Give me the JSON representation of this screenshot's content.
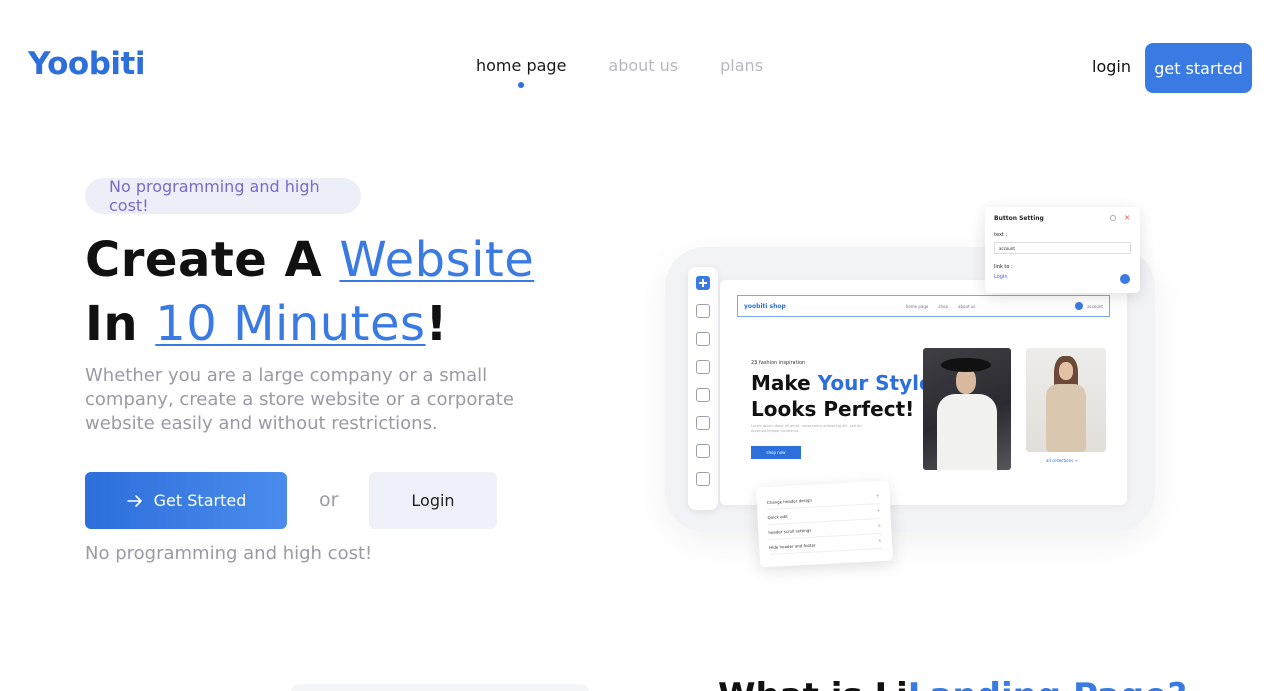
{
  "header": {
    "logo": "Yoobiti",
    "nav": [
      {
        "label": "home page",
        "active": true
      },
      {
        "label": "about us",
        "active": false
      },
      {
        "label": "plans",
        "active": false
      }
    ],
    "login_label": "login",
    "get_started_label": "get started"
  },
  "hero": {
    "pill": "No programming and high cost!",
    "title_line1_prefix": "Create A ",
    "title_line1_accent": "Website",
    "title_line2_prefix": "In ",
    "title_line2_accent": "10 Minutes",
    "title_line2_suffix": "!",
    "description": "Whether you are a large company or a small company, create a store website or a corporate website easily and without restrictions.",
    "cta_primary": "Get Started",
    "or_text": "or",
    "cta_login": "Login",
    "subline": "No programming and high cost!"
  },
  "mockup": {
    "site_logo": "yoobiti shop",
    "nav_links": [
      "home page",
      "shop",
      "about us"
    ],
    "account": "account",
    "small_caption": "23 fashion inspiration",
    "headline_1": "Make ",
    "headline_1_blue": "Your Style",
    "headline_2": "Looks Perfect!",
    "lorem": "Lorem ipsum dolor sit amet, consectetur adipiscing elit, sed do eiusmod tempor incididunt.",
    "shop_button": "shop now",
    "collections_link": "all collections →",
    "settings_panel": {
      "title": "Button Setting",
      "text_label": "text :",
      "text_value": "account",
      "link_label": "link to :",
      "link_value": "Login"
    },
    "list_panel": [
      "Change header design",
      "Quick edit",
      "header scroll settings",
      "Hide header and footer"
    ]
  },
  "bottom": {
    "title_black": "What is Li",
    "title_blue": "Landing Page?"
  },
  "colors": {
    "brand": "#2d6fdb",
    "accent": "#3a7be3",
    "muted": "#9a9aa4",
    "pill_text": "#7a6bc9"
  }
}
